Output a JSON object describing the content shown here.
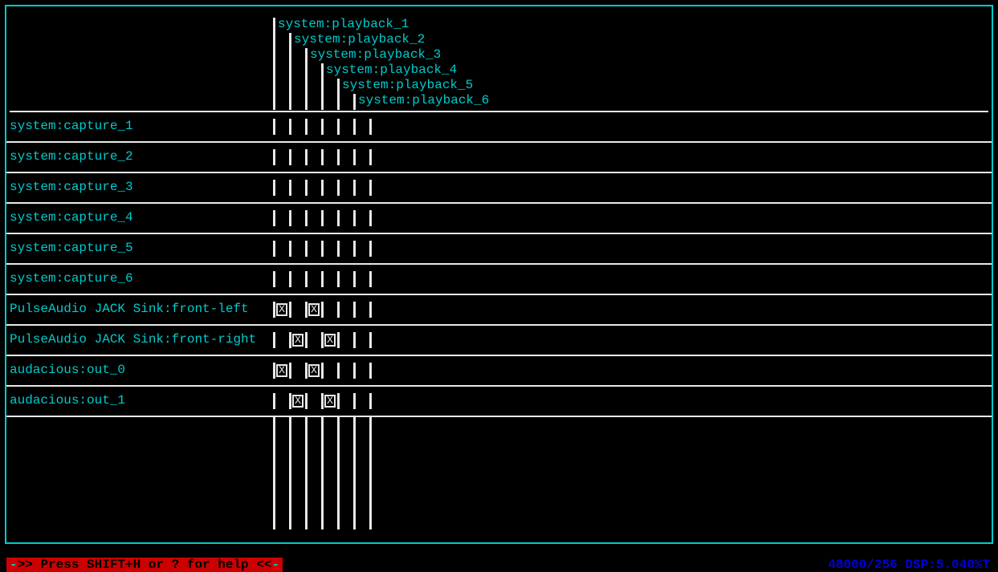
{
  "output_ports": [
    "system:playback_1",
    "system:playback_2",
    "system:playback_3",
    "system:playback_4",
    "system:playback_5",
    "system:playback_6"
  ],
  "input_ports": [
    {
      "label": "system:capture_1",
      "conn": [
        false,
        false,
        false,
        false,
        false,
        false
      ]
    },
    {
      "label": "system:capture_2",
      "conn": [
        false,
        false,
        false,
        false,
        false,
        false
      ]
    },
    {
      "label": "system:capture_3",
      "conn": [
        false,
        false,
        false,
        false,
        false,
        false
      ]
    },
    {
      "label": "system:capture_4",
      "conn": [
        false,
        false,
        false,
        false,
        false,
        false
      ]
    },
    {
      "label": "system:capture_5",
      "conn": [
        false,
        false,
        false,
        false,
        false,
        false
      ]
    },
    {
      "label": "system:capture_6",
      "conn": [
        false,
        false,
        false,
        false,
        false,
        false
      ]
    },
    {
      "label": "PulseAudio JACK Sink:front-left",
      "conn": [
        true,
        false,
        true,
        false,
        false,
        false
      ]
    },
    {
      "label": "PulseAudio JACK Sink:front-right",
      "conn": [
        false,
        true,
        false,
        true,
        false,
        false
      ]
    },
    {
      "label": "audacious:out_0",
      "conn": [
        true,
        false,
        true,
        false,
        false,
        false
      ]
    },
    {
      "label": "audacious:out_1",
      "conn": [
        false,
        true,
        false,
        true,
        false,
        false
      ]
    }
  ],
  "help_prefix": "-",
  "help_text": ">> Press SHIFT+H or ? for help <<",
  "help_suffix": "-",
  "status": "48000/256 DSP:5.040%T"
}
